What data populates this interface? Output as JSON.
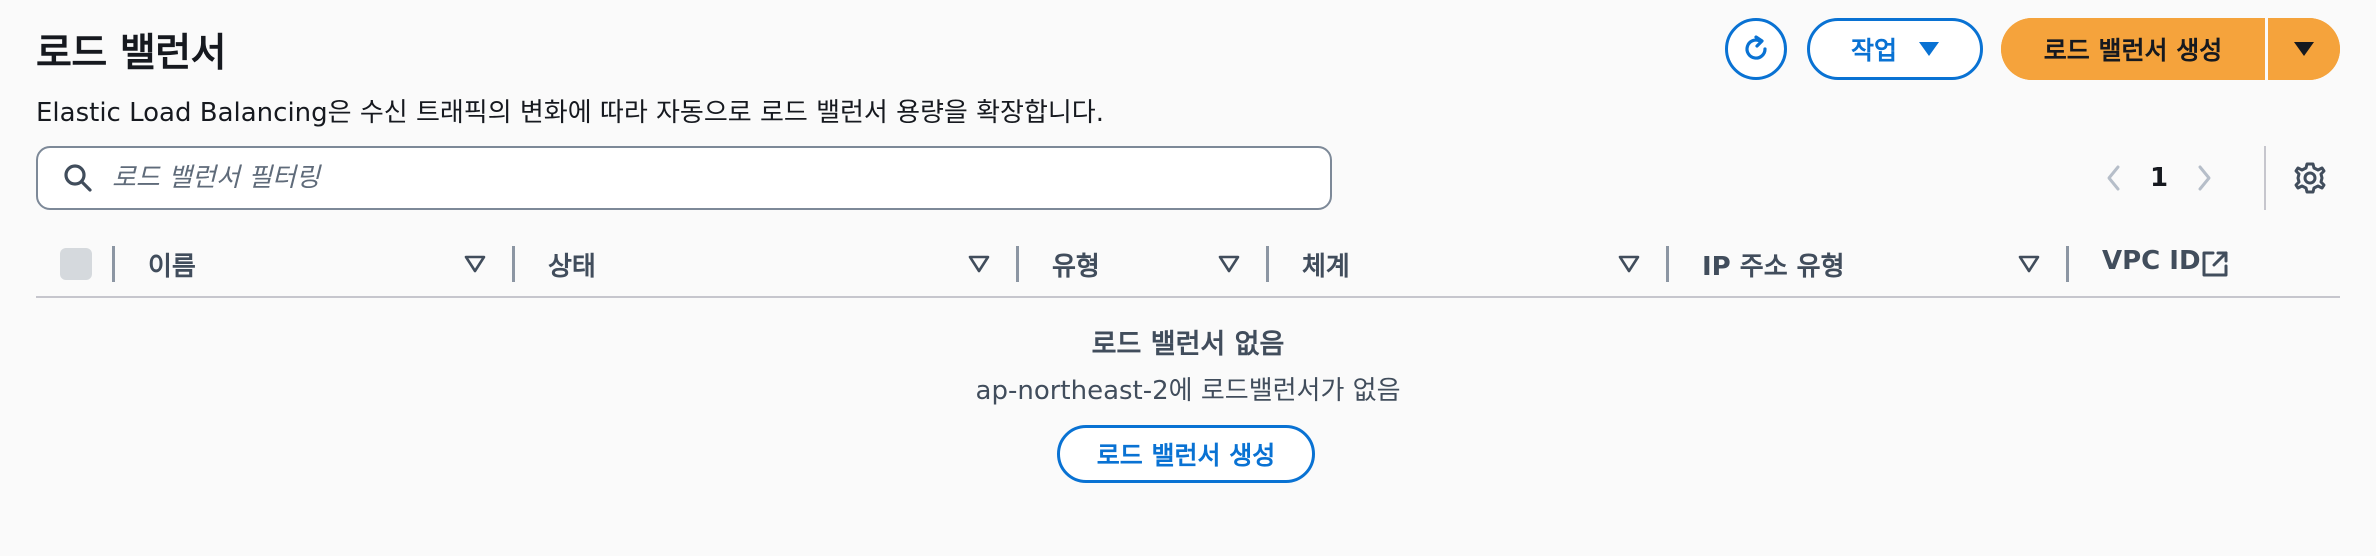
{
  "header": {
    "title": "로드 밸런서",
    "description": "Elastic Load Balancing은 수신 트래픽의 변화에 따라 자동으로 로드 밸런서 용량을 확장합니다.",
    "actions_label": "작업",
    "create_label": "로드 밸런서 생성"
  },
  "search": {
    "placeholder": "로드 밸런서 필터링",
    "value": ""
  },
  "pagination": {
    "current_page": "1"
  },
  "table": {
    "columns": [
      "이름",
      "상태",
      "유형",
      "체계",
      "IP 주소 유형",
      "VPC ID"
    ]
  },
  "empty_state": {
    "title": "로드 밸런서 없음",
    "message": "ap-northeast-2에 로드밸런서가 없음",
    "button_label": "로드 밸런서 생성"
  },
  "icons": {
    "refresh": "refresh-icon",
    "search": "search-icon",
    "settings": "gear-icon",
    "external_link": "external-link-icon",
    "sort": "sort-caret-icon"
  },
  "colors": {
    "primary_accent": "#f5a33c",
    "link_blue": "#0972d3",
    "text_primary": "#16191f",
    "text_secondary": "#414d5c"
  }
}
